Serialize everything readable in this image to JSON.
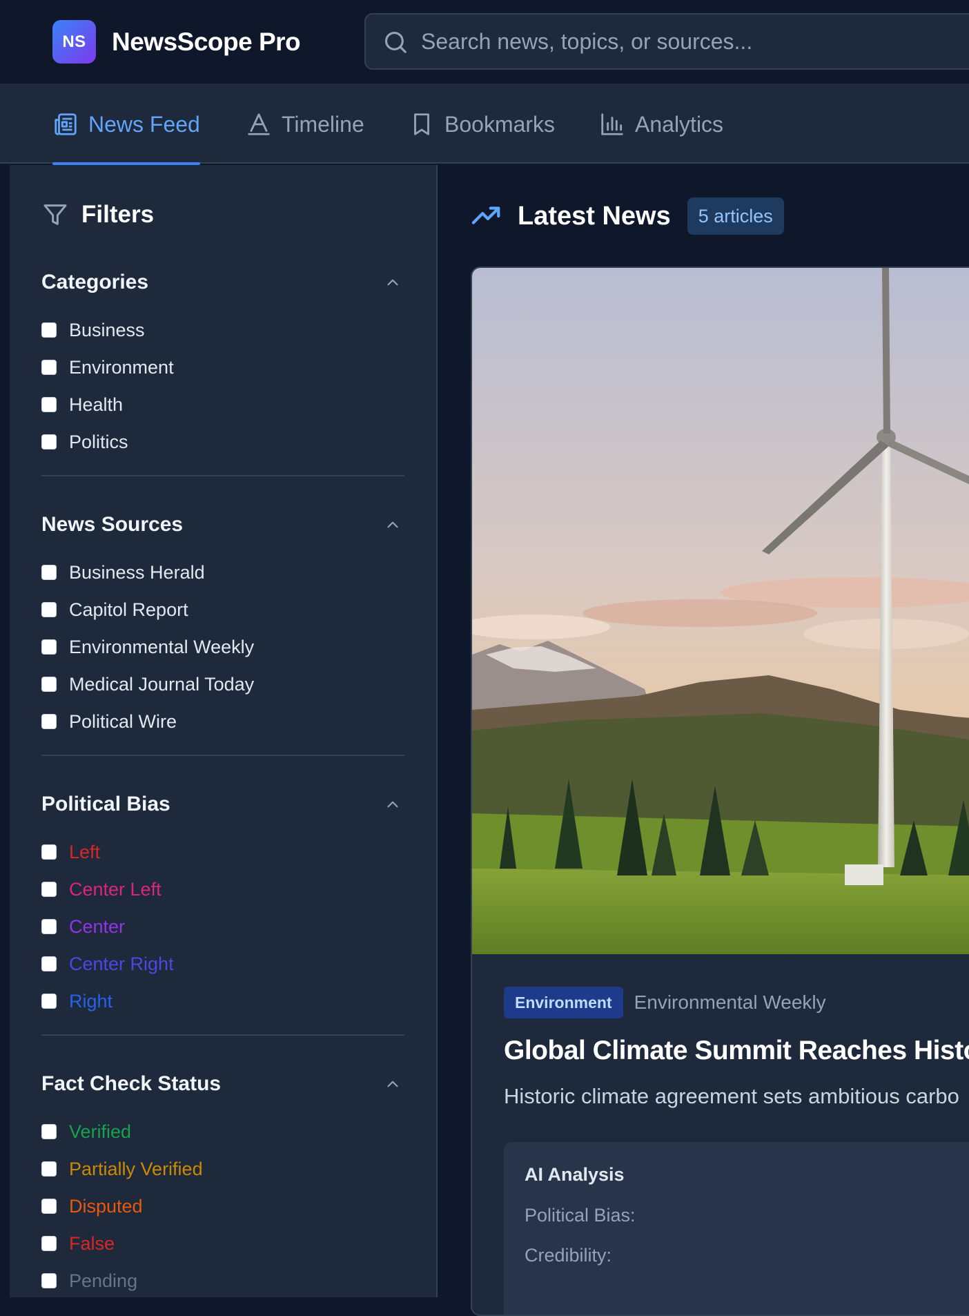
{
  "app": {
    "logo_initials": "NS",
    "title": "NewsScope Pro"
  },
  "search": {
    "placeholder": "Search news, topics, or sources...",
    "value": ""
  },
  "tabs": [
    {
      "label": "News Feed",
      "icon": "newspaper-icon",
      "active": true
    },
    {
      "label": "Timeline",
      "icon": "timeline-icon",
      "active": false
    },
    {
      "label": "Bookmarks",
      "icon": "bookmark-icon",
      "active": false
    },
    {
      "label": "Analytics",
      "icon": "bar-chart-icon",
      "active": false
    }
  ],
  "sidebar": {
    "title": "Filters",
    "groups": [
      {
        "title": "Categories",
        "options": [
          {
            "label": "Business",
            "color": "#e2e8f0"
          },
          {
            "label": "Environment",
            "color": "#e2e8f0"
          },
          {
            "label": "Health",
            "color": "#e2e8f0"
          },
          {
            "label": "Politics",
            "color": "#e2e8f0"
          }
        ]
      },
      {
        "title": "News Sources",
        "options": [
          {
            "label": "Business Herald",
            "color": "#e2e8f0"
          },
          {
            "label": "Capitol Report",
            "color": "#e2e8f0"
          },
          {
            "label": "Environmental Weekly",
            "color": "#e2e8f0"
          },
          {
            "label": "Medical Journal Today",
            "color": "#e2e8f0"
          },
          {
            "label": "Political Wire",
            "color": "#e2e8f0"
          }
        ]
      },
      {
        "title": "Political Bias",
        "options": [
          {
            "label": "Left",
            "color": "#dc2626"
          },
          {
            "label": "Center Left",
            "color": "#db2777"
          },
          {
            "label": "Center",
            "color": "#9333ea"
          },
          {
            "label": "Center Right",
            "color": "#4f46e5"
          },
          {
            "label": "Right",
            "color": "#2563eb"
          }
        ]
      },
      {
        "title": "Fact Check Status",
        "options": [
          {
            "label": "Verified",
            "color": "#16a34a"
          },
          {
            "label": "Partially Verified",
            "color": "#ca8a04"
          },
          {
            "label": "Disputed",
            "color": "#ea580c"
          },
          {
            "label": "False",
            "color": "#dc2626"
          },
          {
            "label": "Pending",
            "color": "#64748b"
          }
        ]
      }
    ]
  },
  "main": {
    "title": "Latest News",
    "count_label": "5 articles",
    "article": {
      "category": "Environment",
      "source": "Environmental Weekly",
      "headline": "Global Climate Summit Reaches Histo",
      "summary": "Historic climate agreement sets ambitious carbo",
      "ai": {
        "title": "AI Analysis",
        "bias_label": "Political Bias:",
        "credibility_label": "Credibility:"
      }
    }
  }
}
